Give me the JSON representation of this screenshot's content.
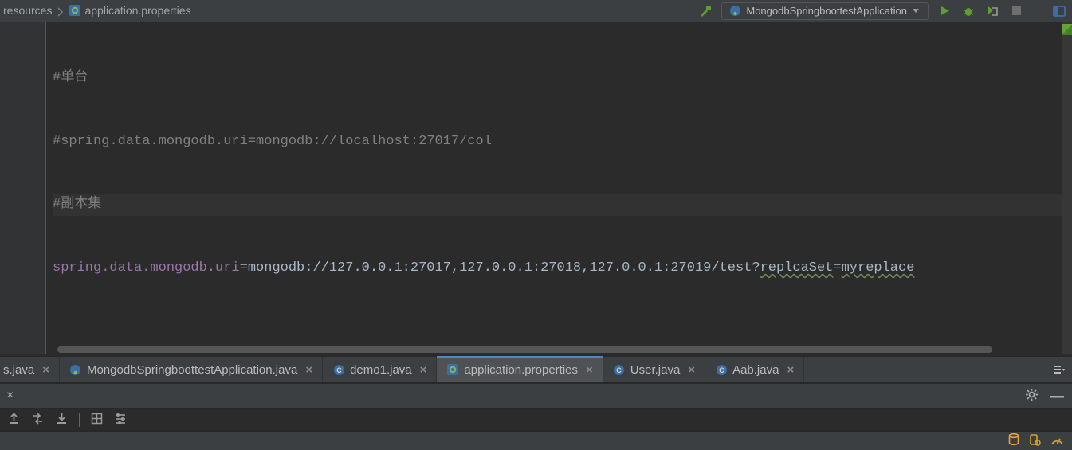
{
  "breadcrumb": {
    "partial_first": "resources",
    "file": "application.properties"
  },
  "run_config": {
    "label": "MongodbSpringboottestApplication"
  },
  "code": {
    "line1": "#单台",
    "line2": "#spring.data.mongodb.uri=mongodb://localhost:27017/col",
    "line3": "#副本集",
    "line4_key": "spring.data.mongodb.uri",
    "line4_eq": "=",
    "line4_v1": "mongodb://127.0.0.1:27017,127.0.0.1:27018,127.0.0.1:27019/test?",
    "line4_typo1": "replcaSet",
    "line4_eq2": "=",
    "line4_typo2": "myreplace"
  },
  "tabs": {
    "partial": "s.java",
    "t1": "MongodbSpringboottestApplication.java",
    "t2": "demo1.java",
    "t3": "application.properties",
    "t4": "User.java",
    "t5": "Aab.java"
  }
}
